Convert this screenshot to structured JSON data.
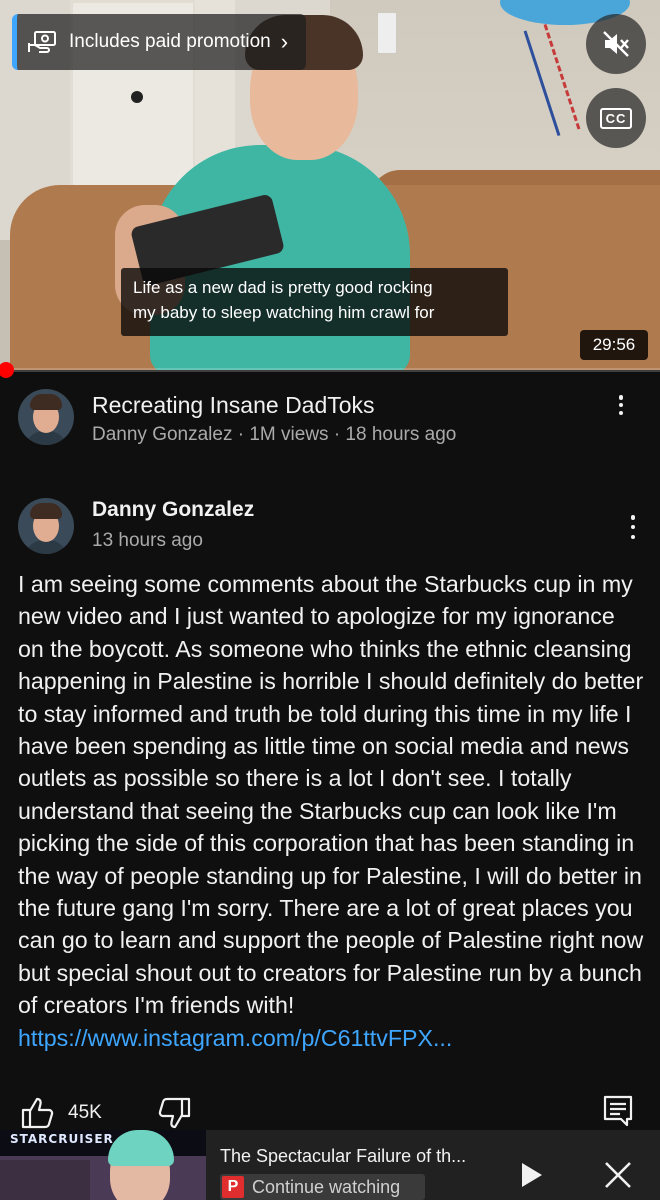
{
  "player": {
    "promo_label": "Includes paid promotion",
    "promo_chevron": "›",
    "caption_line1": "Life as a new dad is pretty good rocking",
    "caption_line2": "my baby to sleep watching him crawl for",
    "duration": "29:56",
    "progress_fraction": 0.01,
    "icons": [
      "paid-promotion-icon",
      "mute-icon",
      "closed-captions-icon"
    ],
    "cc_label": "CC"
  },
  "video": {
    "title": "Recreating Insane DadToks",
    "meta": "Danny Gonzalez · 1M views · 18 hours ago"
  },
  "post": {
    "author": "Danny Gonzalez",
    "time": "13 hours ago",
    "body": "I am seeing some comments about the Starbucks cup in my new video and I just wanted to apologize for my ignorance on the boycott. As someone who thinks the ethnic cleansing happening in Palestine is horrible I should definitely do better to stay informed and truth be told during this time in my life I have been spending as little time on social media and news outlets as possible so there is a lot I don't see. I totally understand that seeing the Starbucks cup can look like I'm picking the side of this corporation that has been standing in the way of people standing up for Palestine, I will do better in the future gang I'm sorry. There are a lot of great places you can go to learn and support the people of Palestine right now but special shout out to creators for Palestine run by a bunch of creators I'm friends with! ",
    "link": "https://www.instagram.com/p/C61ttvFPX...",
    "like_count": "45K"
  },
  "mini_player": {
    "thumb_logo": "STARCRUISER",
    "title": "The Spectacular Failure of th...",
    "badge_letter": "P",
    "badge_text": "Continue watching"
  },
  "colors": {
    "background": "#0f0f0f",
    "accent_link": "#3ea6ff",
    "progress": "#ff0000",
    "secondary_text": "#aaaaaa"
  }
}
